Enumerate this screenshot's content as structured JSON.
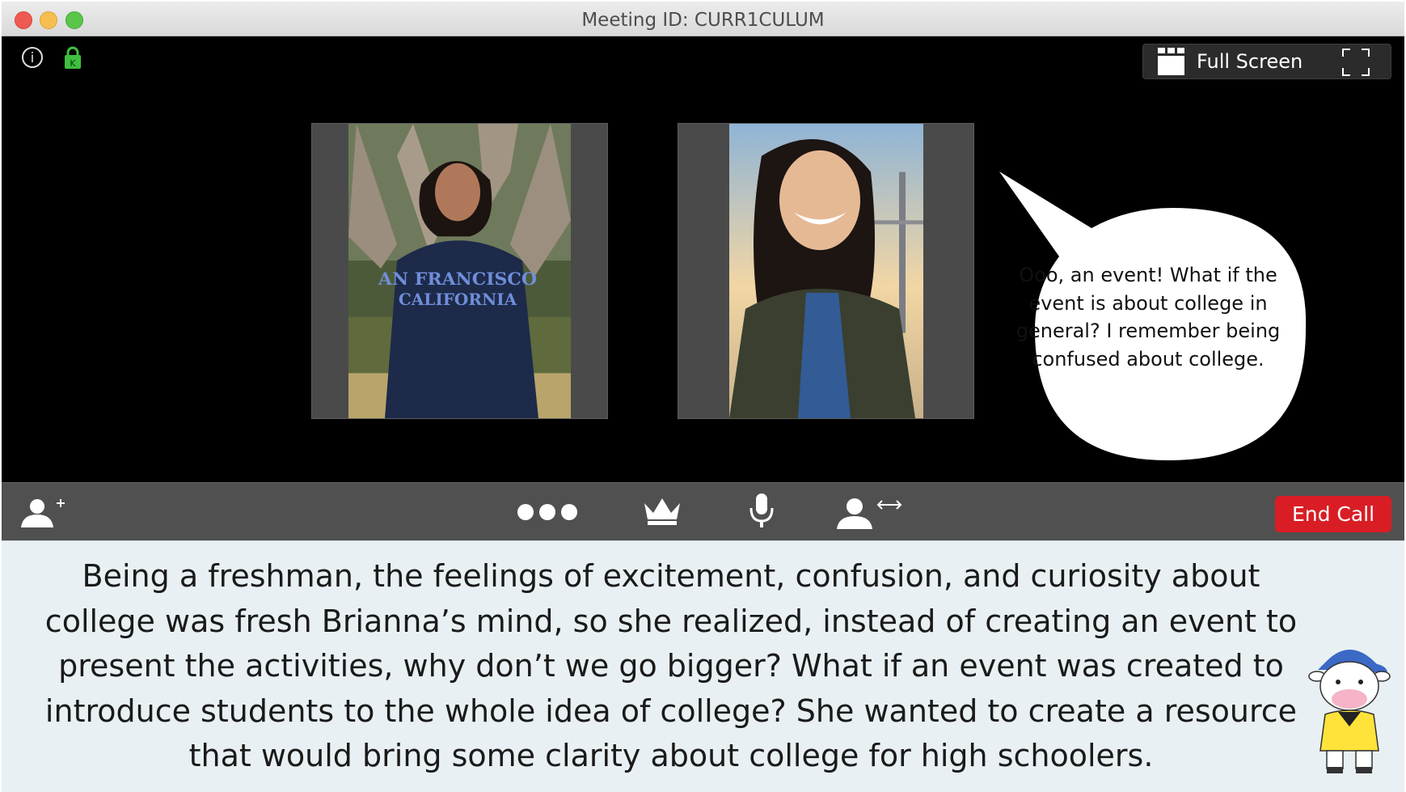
{
  "window": {
    "title": "Meeting ID: CURR1CULUM"
  },
  "stage": {
    "full_screen_label": "Full Screen",
    "speech_bubble": "Ooo, an event! What if the event is about college in general? I remember being confused about college."
  },
  "toolbar": {
    "end_call_label": "End Call",
    "icons": [
      "add-participant-icon",
      "more-options-icon",
      "host-crown-icon",
      "microphone-icon",
      "swap-participant-icon"
    ]
  },
  "caption": {
    "text": "Being a freshman, the feelings of excitement, confusion, and curiosity about college was fresh Brianna’s mind, so she realized, instead of creating an event to present the activities, why don’t we go bigger? What if an event was created to introduce students to the whole idea of college? She wanted to create a resource that would bring some clarity about college for high schoolers."
  },
  "colors": {
    "end_call": "#d91d25",
    "lock_icon": "#3fbf3f",
    "caption_background": "#e9f0f3",
    "toolbar_background": "#505050"
  }
}
